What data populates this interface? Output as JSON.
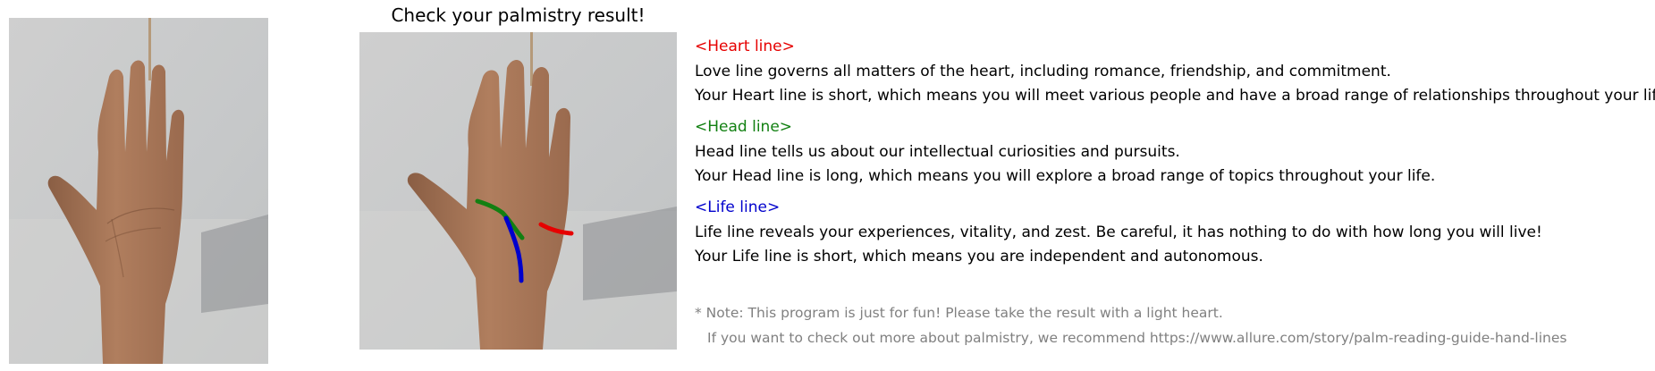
{
  "title": "Check your palmistry result!",
  "images": {
    "original": "hand-photo-original",
    "annotated": "hand-photo-with-lines"
  },
  "colors": {
    "heart": "#e60000",
    "head": "#128012",
    "life": "#0000cc",
    "note": "#808080"
  },
  "sections": {
    "heart": {
      "header": "<Heart line>",
      "desc": "Love line governs all matters of the heart, including romance, friendship, and commitment.",
      "result": "Your Heart line is short, which means you will meet various people and have a broad range of relationships throughout your life."
    },
    "head": {
      "header": "<Head line>",
      "desc": "Head line tells us about our intellectual curiosities and pursuits.",
      "result": "Your Head line is long, which means you will explore a broad range of topics throughout your life."
    },
    "life": {
      "header": "<Life line>",
      "desc": "Life line reveals your experiences, vitality, and zest. Be careful, it has nothing to do with how long you will live!",
      "result": "Your Life line is short, which means you are independent and autonomous."
    }
  },
  "note": {
    "line1": "* Note: This program is just for fun! Please take the result with a light heart.",
    "line2": "If you want to check out more about palmistry, we recommend https://www.allure.com/story/palm-reading-guide-hand-lines"
  }
}
